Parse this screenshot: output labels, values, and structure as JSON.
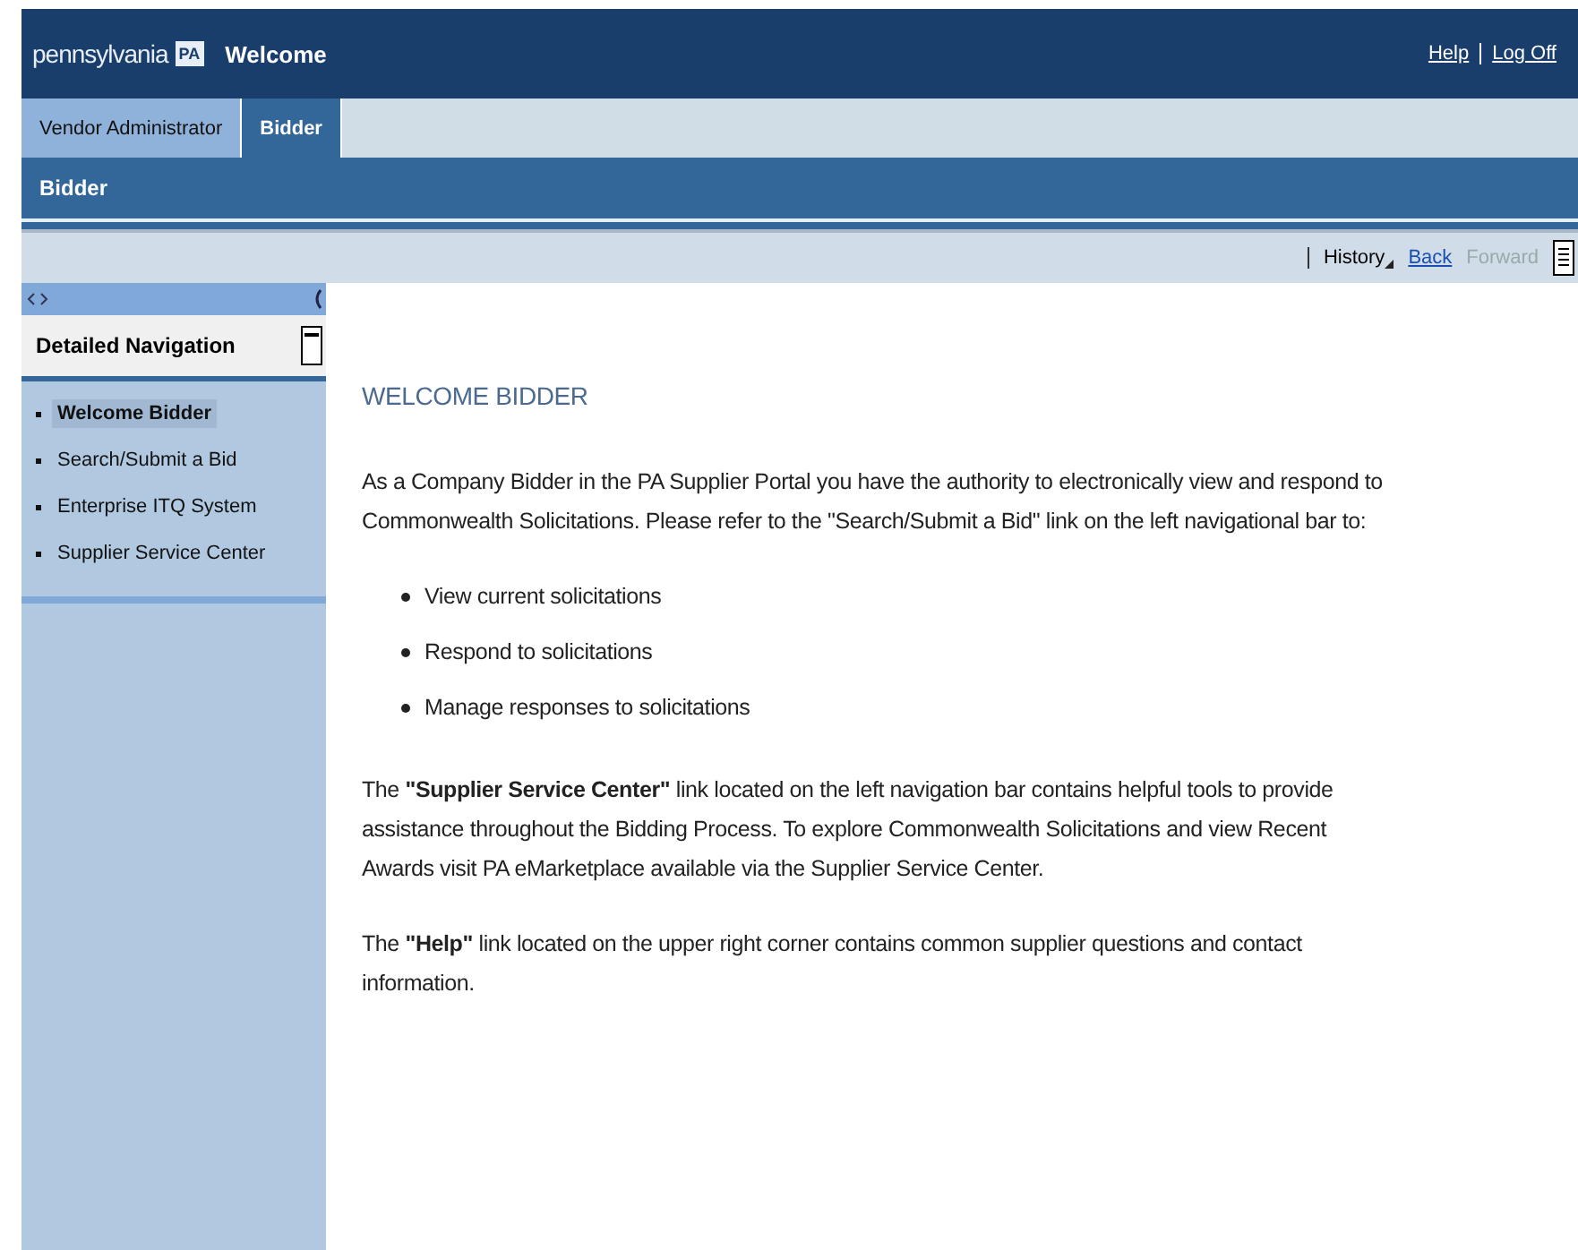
{
  "header": {
    "logo": "pennsylvania",
    "logo_badge": "PA",
    "title": "Welcome",
    "links": [
      "Help",
      "Log Off"
    ]
  },
  "tabs": [
    {
      "label": "Vendor Administrator",
      "selected": false
    },
    {
      "label": "Bidder",
      "selected": true
    }
  ],
  "subheader": {
    "title": "Bidder"
  },
  "toolbar": {
    "history": "History",
    "links": [
      {
        "label": "Back",
        "disabled": false
      },
      {
        "label": "Forward",
        "disabled": true
      }
    ]
  },
  "navigation": {
    "title": "Detailed Navigation",
    "items": [
      {
        "label": "Welcome Bidder",
        "selected": true
      },
      {
        "label": "Search/Submit a Bid",
        "selected": false
      },
      {
        "label": "Enterprise ITQ System",
        "selected": false
      },
      {
        "label": "Supplier Service Center",
        "selected": false
      }
    ]
  },
  "content": {
    "heading": "WELCOME BIDDER",
    "intro": "As a Company Bidder in the PA Supplier Portal you have the authority to electronically view and respond to Commonwealth Solicitations.  Please refer to the \"Search/Submit a Bid\" link on the left navigational bar to:",
    "bullets": [
      "View current solicitations",
      "Respond to solicitations",
      "Manage responses to solicitations"
    ],
    "paragraphs": [
      "The **\"Supplier Service Center\"** link located on the left navigation bar contains helpful tools to provide assistance throughout the Bidding Process.  To explore Commonwealth Solicitations and view Recent Awards visit PA eMarketplace available via the Supplier Service Center.",
      "The **\"Help\"** link located on the upper right corner contains common supplier questions and contact information."
    ]
  }
}
